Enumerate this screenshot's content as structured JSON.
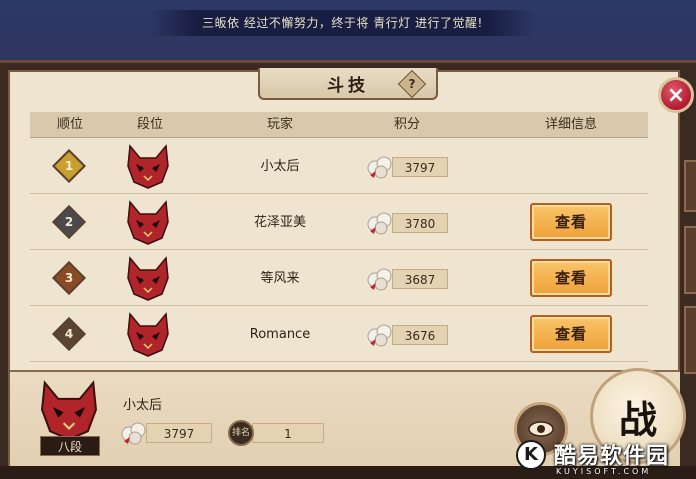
{
  "notice": "三皈依 经过不懈努力，终于将 青行灯 进行了觉醒!",
  "title": "斗技",
  "help": "?",
  "close": "×",
  "columns": {
    "rank": "顺位",
    "tier": "段位",
    "player": "玩家",
    "score": "积分",
    "details": "详细信息"
  },
  "rows": [
    {
      "rank": "1",
      "name": "小太后",
      "score": "3797",
      "button": "",
      "badge_color": "#c9a030"
    },
    {
      "rank": "2",
      "name": "花泽亚美",
      "score": "3780",
      "button": "查看",
      "badge_color": "#4a4a4e"
    },
    {
      "rank": "3",
      "name": "等风来",
      "score": "3687",
      "button": "查看",
      "badge_color": "#8a4a24"
    },
    {
      "rank": "4",
      "name": "Romance",
      "score": "3676",
      "button": "查看",
      "badge_color": "#5a4432"
    }
  ],
  "self": {
    "name": "小太后",
    "tier": "八段",
    "score": "3797",
    "rank_label": "排名",
    "rank": "1"
  },
  "battle": "战",
  "watermark": {
    "text": "酷易软件园",
    "sub": "KUYISOFT.COM"
  }
}
